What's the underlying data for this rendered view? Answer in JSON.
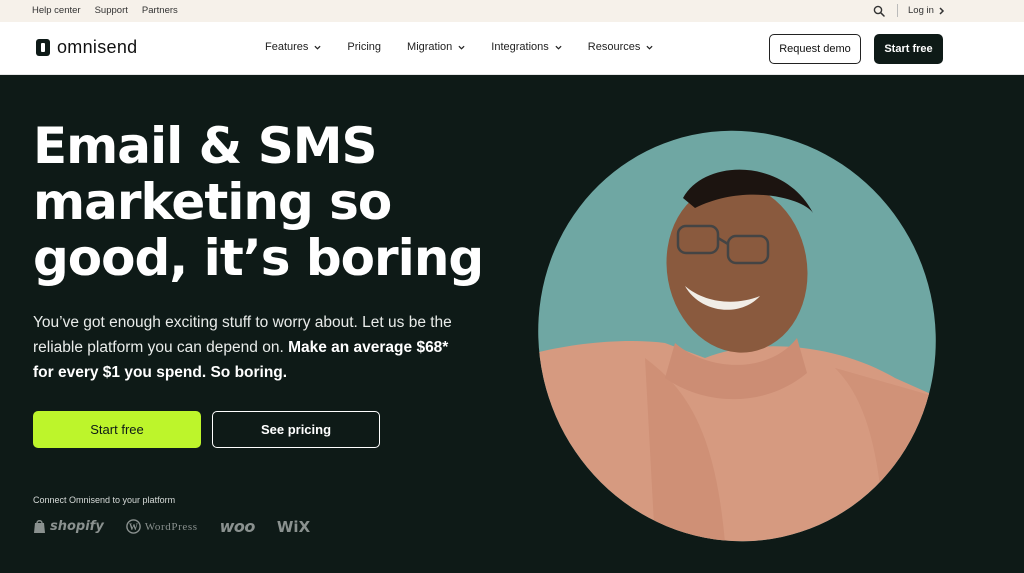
{
  "utility_bar": {
    "links": [
      "Help center",
      "Support",
      "Partners"
    ],
    "search_icon": "search-icon",
    "login_label": "Log in"
  },
  "nav": {
    "brand": "omnisend",
    "menu": [
      {
        "label": "Features",
        "has_dropdown": true
      },
      {
        "label": "Pricing",
        "has_dropdown": false
      },
      {
        "label": "Migration",
        "has_dropdown": true
      },
      {
        "label": "Integrations",
        "has_dropdown": true
      },
      {
        "label": "Resources",
        "has_dropdown": true
      }
    ],
    "request_demo_label": "Request demo",
    "start_free_label": "Start free"
  },
  "hero": {
    "title_line1": "Email & SMS",
    "title_line2": "marketing so",
    "title_line3": "good, it’s boring",
    "subtitle_plain": "You’ve got enough exciting stuff to worry about. Let us be the reliable platform you can depend on. ",
    "subtitle_strong": "Make an average $68* for every $1 you spend. So boring.",
    "cta_primary": "Start free",
    "cta_secondary": "See pricing",
    "connect_text": "Connect Omnisend to your platform",
    "platforms": [
      "shopify",
      "WordPress",
      "woo",
      "WiX"
    ]
  },
  "colors": {
    "background": "#0e1a17",
    "accent": "#bdf52b",
    "utility_bar": "#f6f1ea",
    "photo_backdrop": "#6fa7a3",
    "sweater": "#d69a80"
  }
}
